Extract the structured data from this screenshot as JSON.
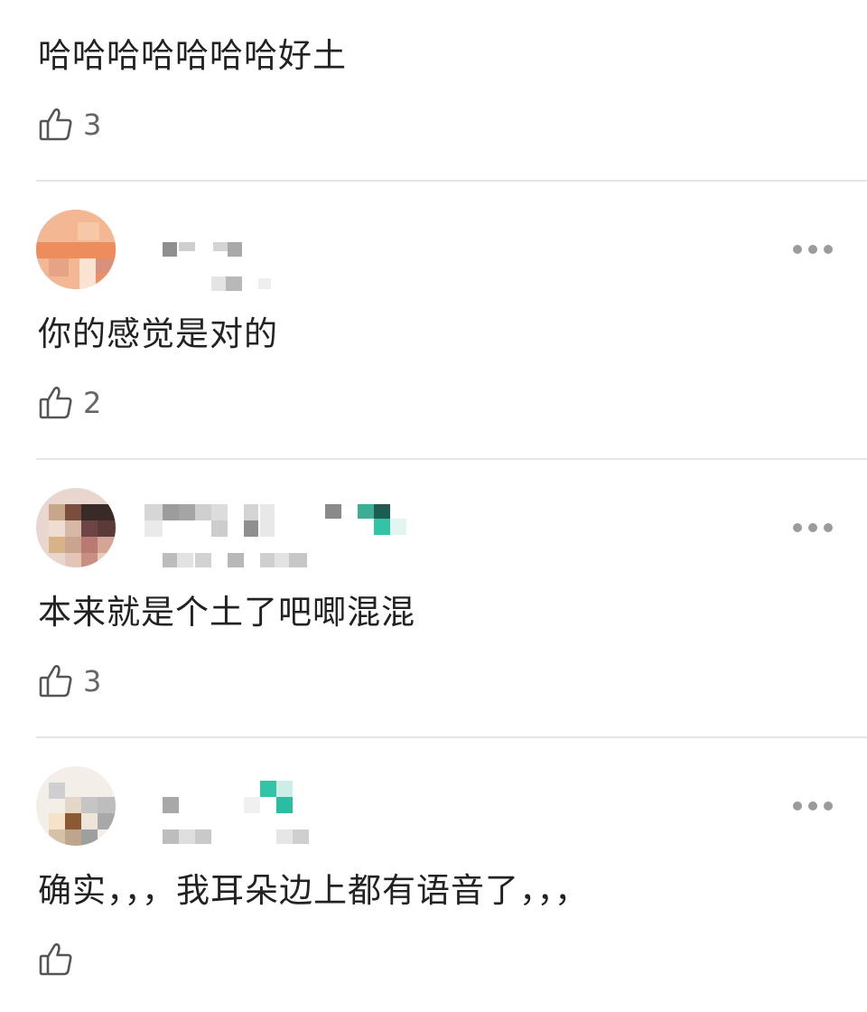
{
  "comments": [
    {
      "text": "哈哈哈哈哈哈哈好土",
      "likes": "3",
      "like_icon": "thumbs-up-icon",
      "more_icon": "more-dots-icon",
      "user_info_obscured": true
    },
    {
      "text": "你的感觉是对的",
      "likes": "2",
      "like_icon": "thumbs-up-icon",
      "more_icon": "more-dots-icon",
      "user_info_obscured": true
    },
    {
      "text": "本来就是个土了吧唧混混",
      "likes": "3",
      "like_icon": "thumbs-up-icon",
      "more_icon": "more-dots-icon",
      "user_info_obscured": true
    },
    {
      "text": "确实，，，我耳朵边上都有语音了，，，",
      "likes": "",
      "like_icon": "thumbs-up-icon",
      "more_icon": "more-dots-icon",
      "user_info_obscured": true
    }
  ],
  "colors": {
    "text": "#222222",
    "count": "#666666",
    "divider": "#e6e6e6",
    "more_dots": "#9b9b9b",
    "mosaic_teal": "#33c4a7"
  }
}
